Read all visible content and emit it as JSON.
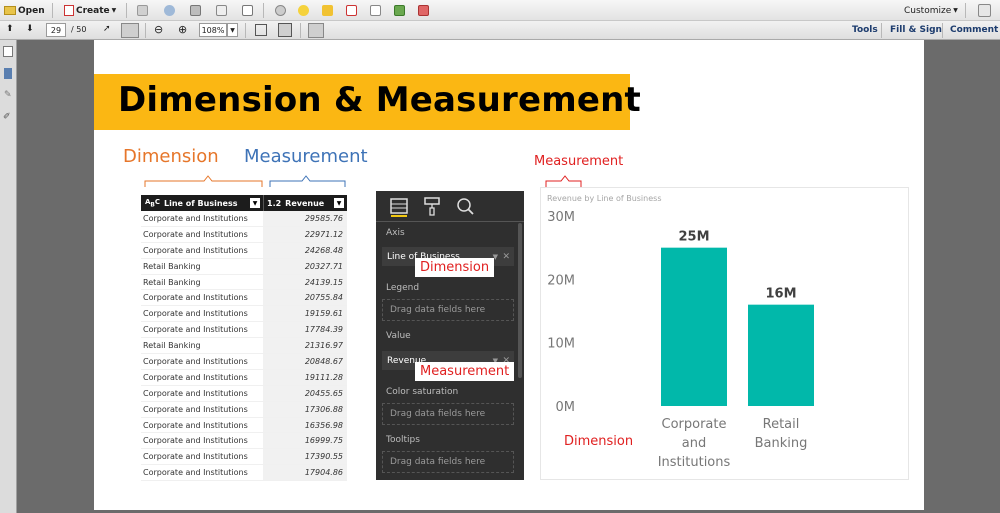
{
  "toolbar": {
    "open_label": "Open",
    "create_label": "Create",
    "customize_label": "Customize",
    "page_current": "29",
    "page_total": "/ 50",
    "zoom": "108%",
    "tools_label": "Tools",
    "fill_sign_label": "Fill & Sign",
    "comment_label": "Comment"
  },
  "slide": {
    "title": "Dimension & Measurement",
    "dimension_label": "Dimension",
    "measurement_label": "Measurement",
    "measurement_red_label": "Measurement",
    "dimension_red_label": "Dimension"
  },
  "table": {
    "headers": [
      "Line of Business",
      "Revenue"
    ],
    "rows": [
      [
        "Corporate and Institutions",
        "29585.76"
      ],
      [
        "Corporate and Institutions",
        "22971.12"
      ],
      [
        "Corporate and Institutions",
        "24268.48"
      ],
      [
        "Retail Banking",
        "20327.71"
      ],
      [
        "Retail Banking",
        "24139.15"
      ],
      [
        "Corporate and Institutions",
        "20755.84"
      ],
      [
        "Corporate and Institutions",
        "19159.61"
      ],
      [
        "Corporate and Institutions",
        "17784.39"
      ],
      [
        "Retail Banking",
        "21316.97"
      ],
      [
        "Corporate and Institutions",
        "20848.67"
      ],
      [
        "Corporate and Institutions",
        "19111.28"
      ],
      [
        "Corporate and Institutions",
        "20455.65"
      ],
      [
        "Corporate and Institutions",
        "17306.88"
      ],
      [
        "Corporate and Institutions",
        "16356.98"
      ],
      [
        "Corporate and Institutions",
        "16999.75"
      ],
      [
        "Corporate and Institutions",
        "17390.55"
      ],
      [
        "Corporate and Institutions",
        "17904.86"
      ]
    ]
  },
  "fields_panel": {
    "axis_label": "Axis",
    "axis_field": "Line of Business",
    "legend_label": "Legend",
    "legend_drop": "Drag data fields here",
    "value_label": "Value",
    "value_field": "Revenue",
    "color_saturation_label": "Color saturation",
    "color_saturation_drop": "Drag data fields here",
    "tooltips_label": "Tooltips",
    "tooltips_drop": "Drag data fields here",
    "dimension_callout": "Dimension",
    "measurement_callout": "Measurement"
  },
  "chart_data": {
    "type": "bar",
    "title": "Revenue by Line of Business",
    "categories": [
      [
        "Corporate",
        "and",
        "Institutions"
      ],
      [
        "Retail",
        "Banking"
      ]
    ],
    "values": [
      25,
      16
    ],
    "data_labels": [
      "25M",
      "16M"
    ],
    "y_ticks": [
      "0M",
      "10M",
      "20M",
      "30M"
    ],
    "ylim": [
      0,
      30
    ],
    "bar_color": "#01b8aa",
    "grid": false
  },
  "colors": {
    "title_band": "#fbb713",
    "dimension": "#e6762a",
    "measurement": "#3e73b7",
    "annotation": "#e02020"
  }
}
